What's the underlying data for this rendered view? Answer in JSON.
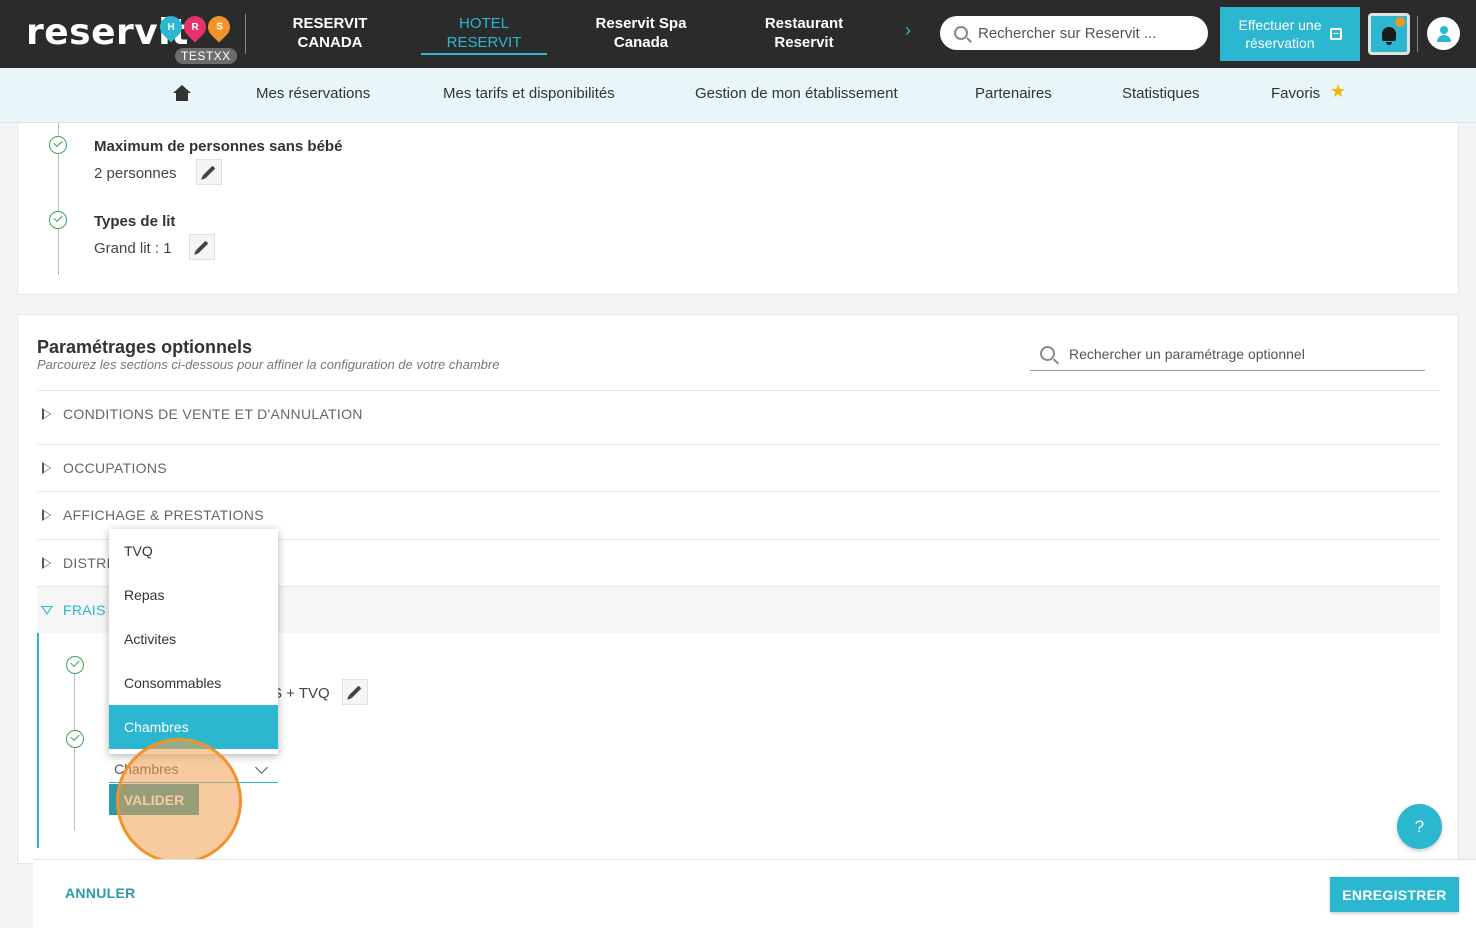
{
  "header": {
    "logo": "reservit",
    "badge": "TESTXX",
    "nav": [
      {
        "line1": "RESERVIT",
        "line2": "CANADA"
      },
      {
        "line1": "HOTEL",
        "line2": "RESERVIT"
      },
      {
        "line1": "Reservit Spa",
        "line2": "Canada"
      },
      {
        "line1": "Restaurant",
        "line2": "Reservit"
      }
    ],
    "search_placeholder": "Rechercher sur Reservit ...",
    "book_line1": "Effectuer une",
    "book_line2": "réservation"
  },
  "subnav": {
    "items": [
      "Mes réservations",
      "Mes tarifs et disponibilités",
      "Gestion de mon établissement",
      "Partenaires",
      "Statistiques",
      "Favoris"
    ]
  },
  "room_card": {
    "fields": [
      {
        "title": "Maximum de personnes sans bébé",
        "value": "2 personnes"
      },
      {
        "title": "Types de lit",
        "value": "Grand lit : 1"
      }
    ]
  },
  "optional": {
    "title": "Paramétrages optionnels",
    "subtitle": "Parcourez les sections ci-dessous pour affiner la configuration de votre chambre",
    "search_placeholder": "Rechercher un paramétrage optionnel",
    "sections": [
      "CONDITIONS DE VENTE ET D'ANNULATION",
      "OCCUPATIONS",
      "AFFICHAGE & PRESTATIONS",
      "DISTRI",
      "FRAIS I"
    ],
    "frais_value_tail": "S + TVQ"
  },
  "dropdown": {
    "options": [
      "TVQ",
      "Repas",
      "Activites",
      "Consommables",
      "Chambres"
    ],
    "selected": "Chambres"
  },
  "select_value": "Chambres",
  "valider_label": "VALIDER",
  "help_label": "?",
  "footer": {
    "cancel": "ANNULER",
    "save": "ENREGISTRER"
  }
}
